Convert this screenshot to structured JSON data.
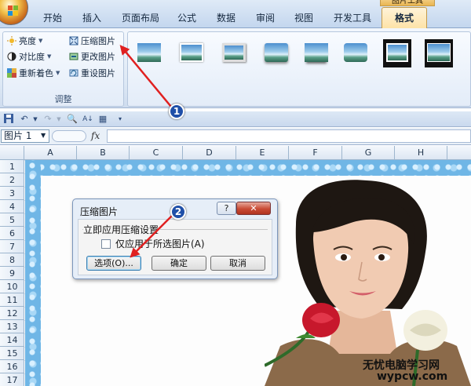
{
  "ribbon": {
    "context_tab_header": "图片工具",
    "tabs": [
      {
        "label": "开始"
      },
      {
        "label": "插入"
      },
      {
        "label": "页面布局"
      },
      {
        "label": "公式"
      },
      {
        "label": "数据"
      },
      {
        "label": "审阅"
      },
      {
        "label": "视图"
      },
      {
        "label": "开发工具"
      },
      {
        "label": "格式"
      }
    ],
    "active_tab": "格式",
    "adjust_group": {
      "label": "调整",
      "commands": [
        {
          "label": "亮度",
          "icon": "brightness-icon",
          "dropdown": true
        },
        {
          "label": "压缩图片",
          "icon": "compress-picture-icon"
        },
        {
          "label": "对比度",
          "icon": "contrast-icon",
          "dropdown": true
        },
        {
          "label": "更改图片",
          "icon": "change-picture-icon"
        },
        {
          "label": "重新着色",
          "icon": "recolor-icon",
          "dropdown": true
        },
        {
          "label": "重设图片",
          "icon": "reset-picture-icon"
        }
      ]
    },
    "picture_styles": [
      "style-1",
      "style-2",
      "style-3",
      "style-4",
      "style-5",
      "style-6",
      "style-7",
      "style-8"
    ]
  },
  "quick_access": [
    "save-icon",
    "undo-icon",
    "redo-icon",
    "print-preview-icon",
    "sort-icon",
    "form-icon",
    "customize-icon"
  ],
  "formula_bar": {
    "name_box": "图片 1",
    "fx": "fx",
    "formula": ""
  },
  "sheet": {
    "columns": [
      "A",
      "B",
      "C",
      "D",
      "E",
      "F",
      "G",
      "H"
    ],
    "rows": [
      "1",
      "2",
      "3",
      "4",
      "5",
      "6",
      "7",
      "8",
      "9",
      "10",
      "11",
      "12",
      "13",
      "14",
      "15",
      "16",
      "17"
    ]
  },
  "dialog": {
    "title": "压缩图片",
    "help_label": "?",
    "close_label": "✕",
    "section_label": "立即应用压缩设置",
    "checkbox_label": "仅应用于所选图片(A)",
    "checkbox_checked": false,
    "buttons": {
      "options": "选项(O)...",
      "ok": "确定",
      "cancel": "取消"
    }
  },
  "annotations": {
    "callout_1": "1",
    "callout_2": "2",
    "arrow_color": "#e02020"
  },
  "watermark": {
    "text": "无忧电脑学习网",
    "url": "wypcw.com"
  },
  "colors": {
    "ribbon_bg": "#dde8f5",
    "frame_blue": "#6fb6e6",
    "close_red": "#c94b35",
    "callout_blue": "#1f4fa8"
  }
}
